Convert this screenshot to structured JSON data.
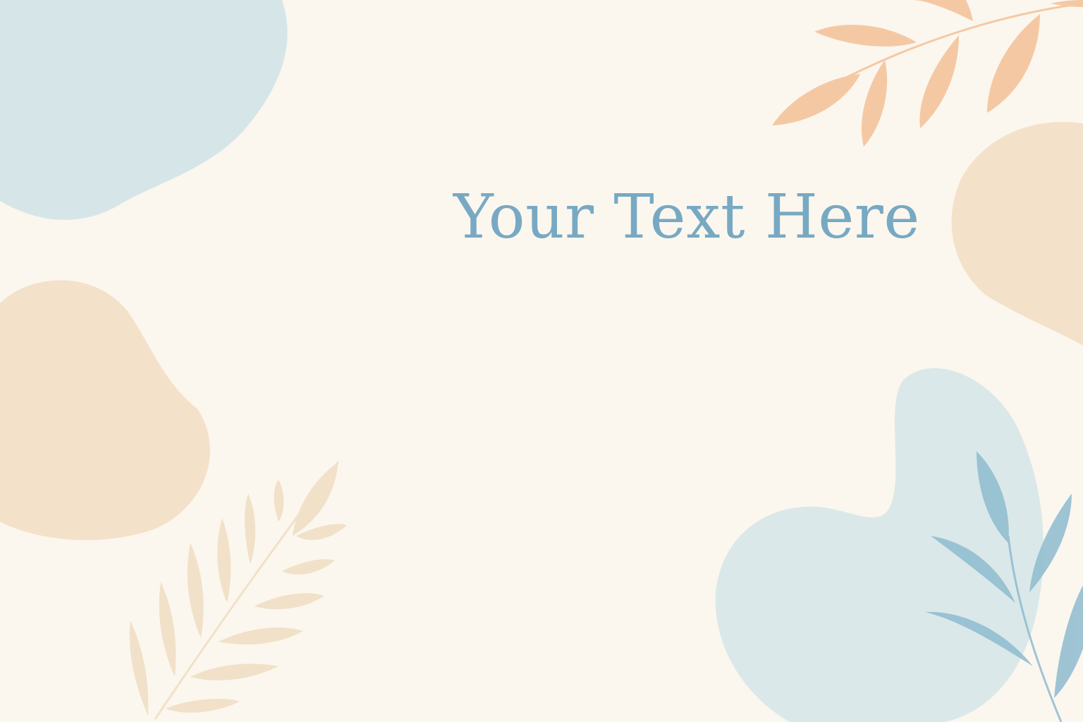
{
  "headline": "Your Text Here",
  "colors": {
    "background": "#fbf7ee",
    "text": "#77a9c3",
    "blue_blob": "#d6e6e8",
    "peach_blob": "#f4e1c9",
    "orange_leaf": "#f5c8a4",
    "beige_leaf": "#f1e1c9",
    "blue_leaf": "#8ebcd0"
  }
}
